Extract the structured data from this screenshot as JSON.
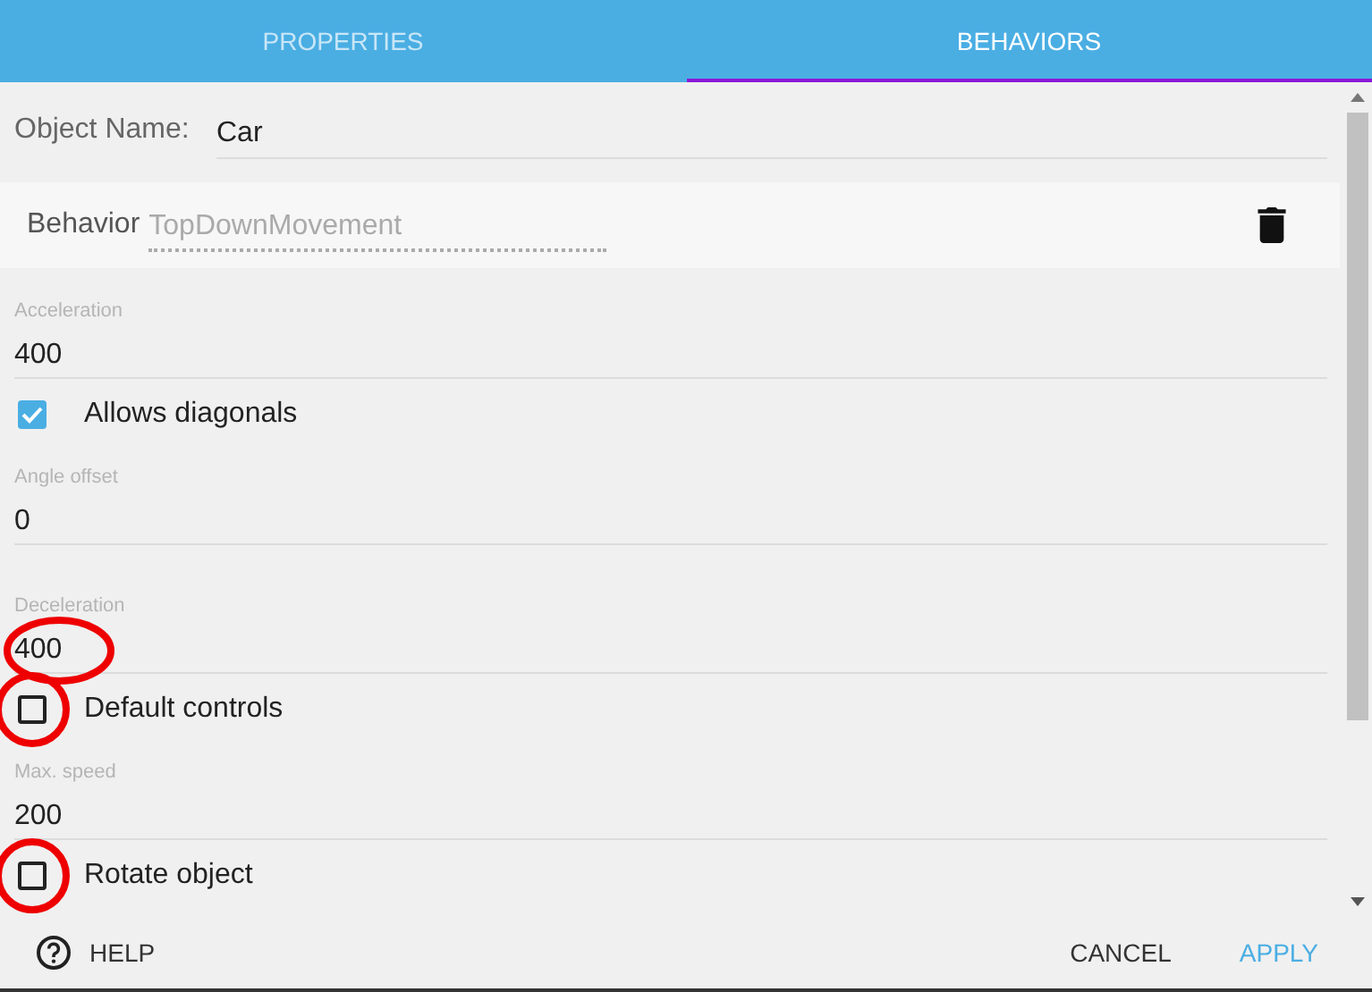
{
  "tabs": [
    {
      "label": "PROPERTIES",
      "selected": false
    },
    {
      "label": "BEHAVIORS",
      "selected": true
    }
  ],
  "object_name": {
    "label": "Object Name:",
    "value": "Car"
  },
  "behavior": {
    "label": "Behavior",
    "value": "TopDownMovement"
  },
  "fields": [
    {
      "kind": "number",
      "label": "Acceleration",
      "value": "400",
      "annotated": false
    },
    {
      "kind": "checkbox",
      "label": "Allows diagonals",
      "checked": true,
      "annotated": false
    },
    {
      "kind": "number",
      "label": "Angle offset",
      "value": "0",
      "annotated": false
    },
    {
      "kind": "number",
      "label": "Deceleration",
      "value": "400",
      "annotated": true
    },
    {
      "kind": "checkbox",
      "label": "Default controls",
      "checked": false,
      "annotated": true
    },
    {
      "kind": "number",
      "label": "Max. speed",
      "value": "200",
      "annotated": false
    },
    {
      "kind": "checkbox",
      "label": "Rotate object",
      "checked": false,
      "annotated": true
    }
  ],
  "footer": {
    "help": "HELP",
    "cancel": "CANCEL",
    "apply": "APPLY"
  }
}
